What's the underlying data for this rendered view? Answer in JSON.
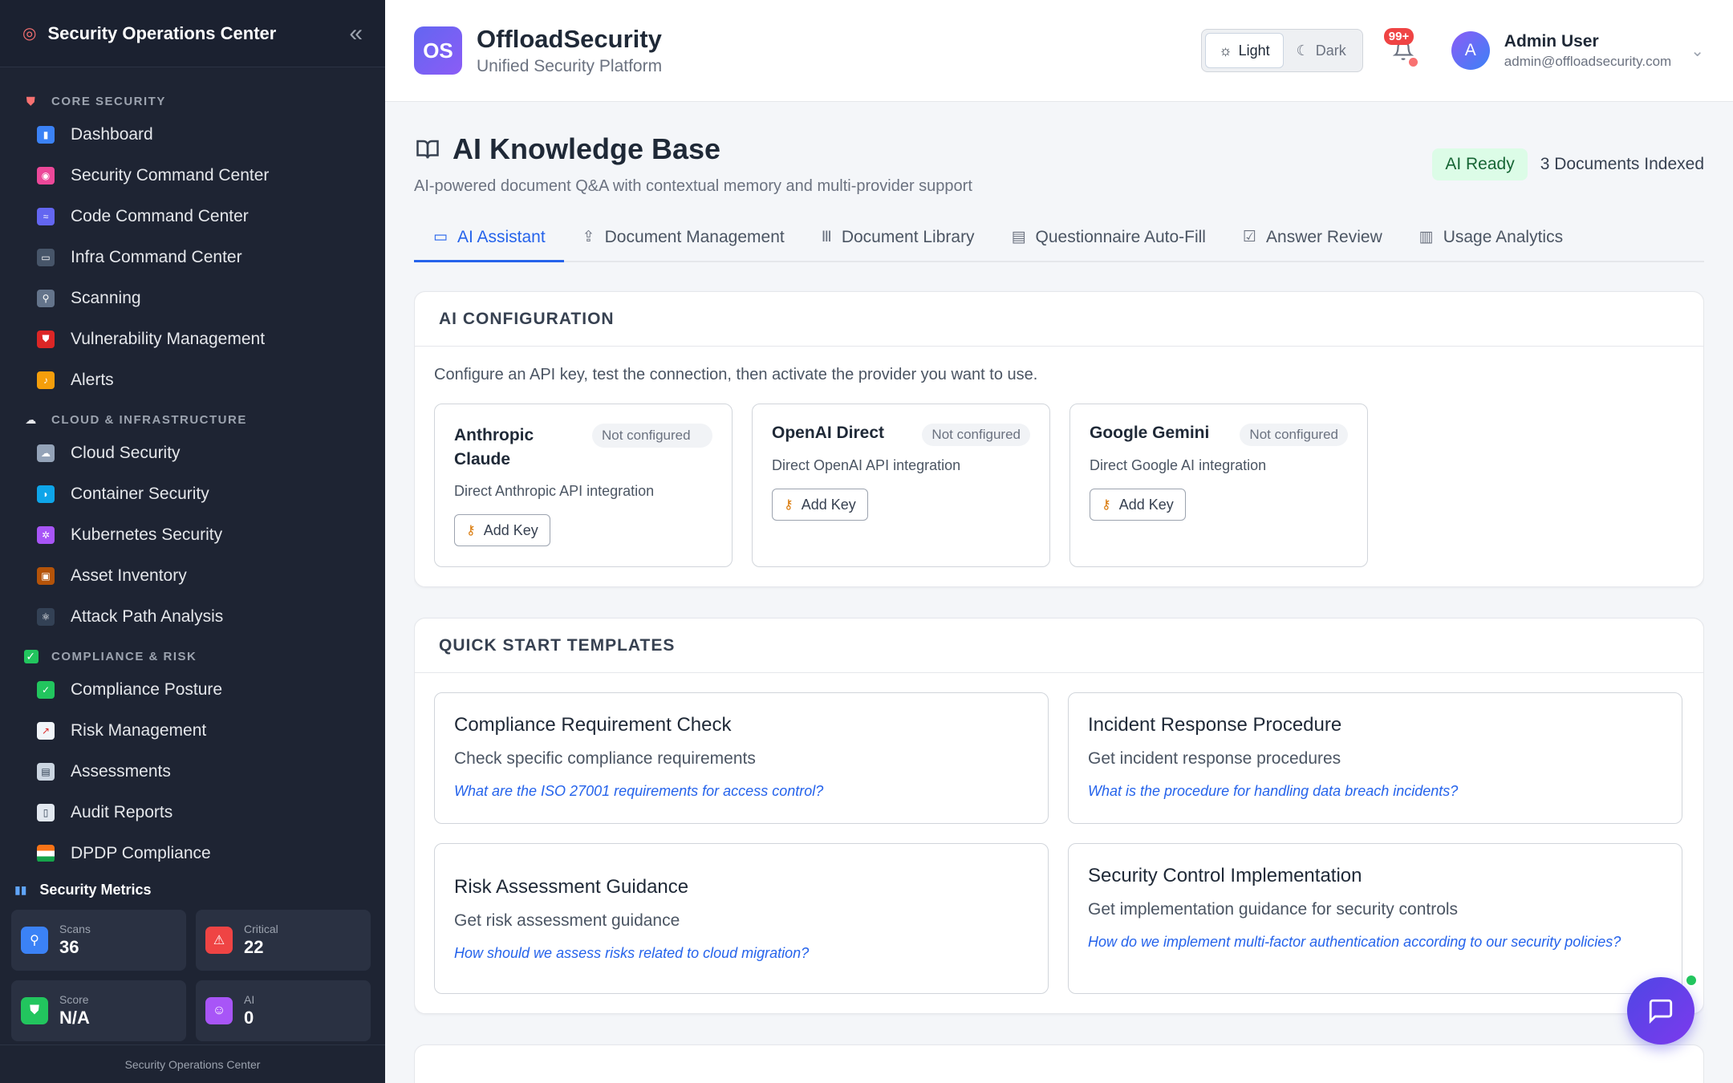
{
  "sidebar": {
    "title": "Security Operations Center",
    "sections": [
      {
        "label": "CORE SECURITY",
        "items": [
          "Dashboard",
          "Security Command Center",
          "Code Command Center",
          "Infra Command Center",
          "Scanning",
          "Vulnerability Management",
          "Alerts"
        ]
      },
      {
        "label": "CLOUD & INFRASTRUCTURE",
        "items": [
          "Cloud Security",
          "Container Security",
          "Kubernetes Security",
          "Asset Inventory",
          "Attack Path Analysis"
        ]
      },
      {
        "label": "COMPLIANCE & RISK",
        "items": [
          "Compliance Posture",
          "Risk Management",
          "Assessments",
          "Audit Reports",
          "DPDP Compliance"
        ]
      }
    ],
    "metrics_title": "Security Metrics",
    "metrics": [
      {
        "label": "Scans",
        "value": "36"
      },
      {
        "label": "Critical",
        "value": "22"
      },
      {
        "label": "Score",
        "value": "N/A"
      },
      {
        "label": "AI",
        "value": "0"
      }
    ],
    "footer": "Security Operations Center"
  },
  "topbar": {
    "badge": "OS",
    "brand": "OffloadSecurity",
    "subtitle": "Unified Security Platform",
    "theme_light": "Light",
    "theme_dark": "Dark",
    "notif_count": "99+",
    "avatar_initial": "A",
    "user_name": "Admin User",
    "user_email": "admin@offloadsecurity.com"
  },
  "page": {
    "title": "AI Knowledge Base",
    "description": "AI-powered document Q&A with contextual memory and multi-provider support",
    "status": "AI Ready",
    "docs_indexed": "3 Documents Indexed"
  },
  "tabs": [
    "AI Assistant",
    "Document Management",
    "Document Library",
    "Questionnaire Auto-Fill",
    "Answer Review",
    "Usage Analytics"
  ],
  "ai_config": {
    "heading": "AI CONFIGURATION",
    "description": "Configure an API key, test the connection, then activate the provider you want to use.",
    "providers": [
      {
        "name": "Anthropic Claude",
        "status": "Not configured",
        "desc": "Direct Anthropic API integration",
        "action": "Add Key"
      },
      {
        "name": "OpenAI Direct",
        "status": "Not configured",
        "desc": "Direct OpenAI API integration",
        "action": "Add Key"
      },
      {
        "name": "Google Gemini",
        "status": "Not configured",
        "desc": "Direct Google AI integration",
        "action": "Add Key"
      }
    ]
  },
  "quick_start": {
    "heading": "QUICK START TEMPLATES",
    "templates": [
      {
        "title": "Compliance Requirement Check",
        "desc": "Check specific compliance requirements",
        "question": "What are the ISO 27001 requirements for access control?"
      },
      {
        "title": "Incident Response Procedure",
        "desc": "Get incident response procedures",
        "question": "What is the procedure for handling data breach incidents?"
      },
      {
        "title": "Risk Assessment Guidance",
        "desc": "Get risk assessment guidance",
        "question": "How should we assess risks related to cloud migration?"
      },
      {
        "title": "Security Control Implementation",
        "desc": "Get implementation guidance for security controls",
        "question": "How do we implement multi-factor authentication according to our security policies?"
      }
    ]
  },
  "colors": {
    "accent": "#2563eb",
    "sidebar_bg": "#1e2433",
    "ready_bg": "#dcfce7",
    "ready_fg": "#166534"
  }
}
